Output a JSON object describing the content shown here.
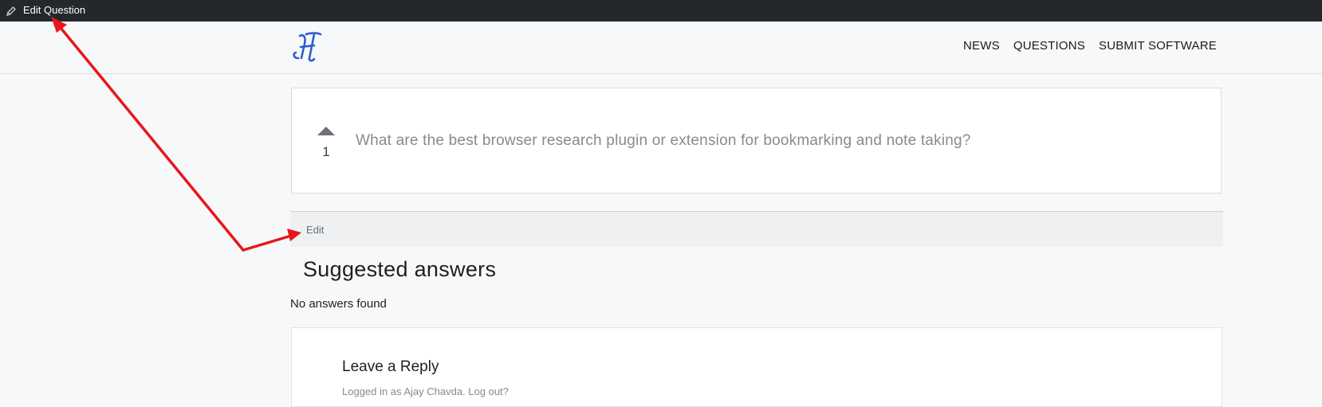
{
  "adminbar": {
    "edit_question_label": "Edit Question",
    "icon": "pencil-icon"
  },
  "header": {
    "logo_text": "H",
    "nav": [
      {
        "label": "NEWS"
      },
      {
        "label": "QUESTIONS"
      },
      {
        "label": "SUBMIT SOFTWARE"
      }
    ]
  },
  "question": {
    "vote_count": "1",
    "title": "What are the best browser research plugin or extension for bookmarking and note taking?"
  },
  "edit_bar": {
    "edit_label": "Edit"
  },
  "answers": {
    "heading": "Suggested answers",
    "empty_text": "No answers found"
  },
  "reply": {
    "title": "Leave a Reply",
    "logged_in_prefix": "Logged in as Ajay Chavda.",
    "logout_label": "Log out?"
  },
  "colors": {
    "annotation_arrow": "#e8161b",
    "logo_blue": "#2f5bd3",
    "admin_bar": "#23282d"
  }
}
